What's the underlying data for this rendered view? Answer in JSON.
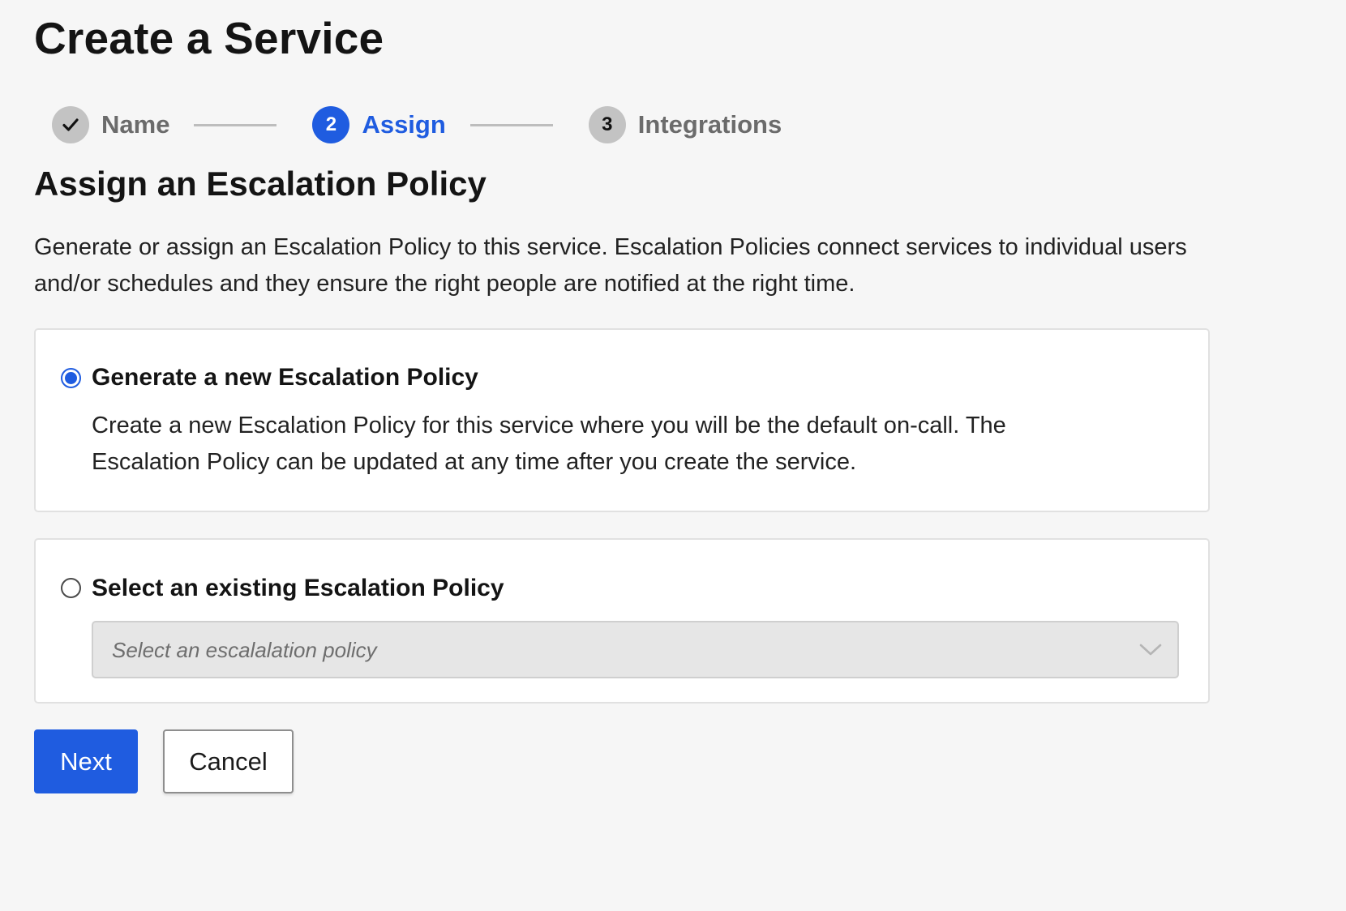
{
  "page": {
    "title": "Create a Service"
  },
  "stepper": {
    "steps": [
      {
        "number": "",
        "label": "Name",
        "status": "completed",
        "icon": "check-icon"
      },
      {
        "number": "2",
        "label": "Assign",
        "status": "active"
      },
      {
        "number": "3",
        "label": "Integrations",
        "status": "pending"
      }
    ]
  },
  "section": {
    "title": "Assign an Escalation Policy",
    "description": "Generate or assign an Escalation Policy to this service. Escalation Policies connect services to individual users and/or schedules and they ensure the right people are notified at the right time."
  },
  "options": {
    "generate_new": {
      "title": "Generate a new Escalation Policy",
      "description": "Create a new Escalation Policy for this service where you will be the default on-call. The Escalation Policy can be updated at any time after you create the service.",
      "selected": true
    },
    "select_existing": {
      "title": "Select an existing Escalation Policy",
      "selected": false,
      "select_placeholder": "Select an escalalation policy",
      "disabled": true
    }
  },
  "actions": {
    "next_label": "Next",
    "cancel_label": "Cancel"
  },
  "colors": {
    "accent": "#1f5ce0",
    "background": "#f6f6f6",
    "step_inactive": "#c3c3c3"
  }
}
